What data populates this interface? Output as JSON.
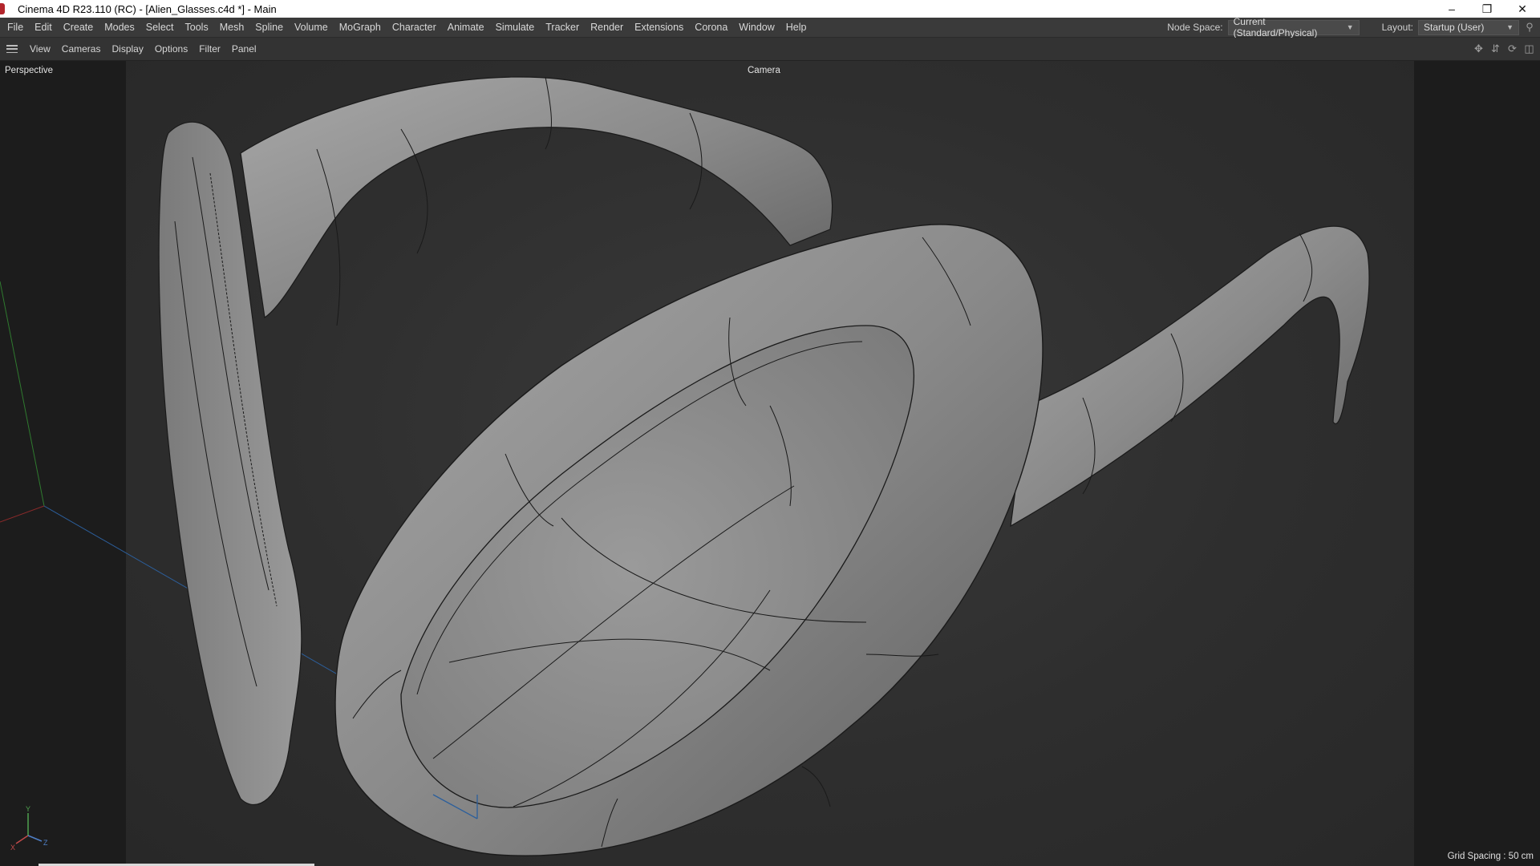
{
  "window": {
    "title": "Cinema 4D R23.110 (RC) - [Alien_Glasses.c4d *] - Main",
    "controls": {
      "minimize": "–",
      "restore": "❐",
      "close": "✕"
    }
  },
  "menubar": {
    "items": [
      "File",
      "Edit",
      "Create",
      "Modes",
      "Select",
      "Tools",
      "Mesh",
      "Spline",
      "Volume",
      "MoGraph",
      "Character",
      "Animate",
      "Simulate",
      "Tracker",
      "Render",
      "Extensions",
      "Corona",
      "Window",
      "Help"
    ],
    "node_space_label": "Node Space:",
    "node_space_value": "Current (Standard/Physical)",
    "layout_label": "Layout:",
    "layout_value": "Startup (User)"
  },
  "viewport_menu": {
    "items": [
      "View",
      "Cameras",
      "Display",
      "Options",
      "Filter",
      "Panel"
    ]
  },
  "viewport": {
    "projection": "Perspective",
    "camera": "Camera",
    "grid_spacing": "Grid Spacing : 50 cm",
    "axis": {
      "x": "X",
      "y": "Y",
      "z": "Z"
    }
  },
  "icons": {
    "menu": "hamburger-icon",
    "search": "search-icon",
    "nav": [
      "move-view-icon",
      "dolly-view-icon",
      "rotate-view-icon",
      "toggle-views-icon"
    ]
  }
}
